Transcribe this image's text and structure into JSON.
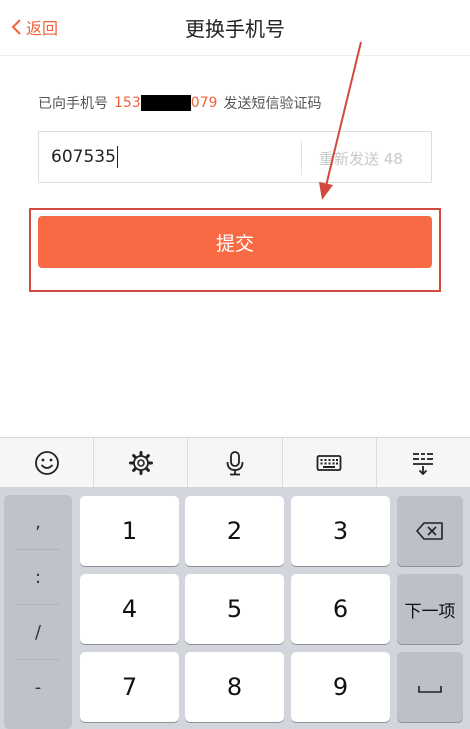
{
  "header": {
    "back_label": "返回",
    "title": "更换手机号"
  },
  "sms_tip": {
    "prefix": "已向手机号",
    "phone_start": "153",
    "phone_end": "079",
    "suffix": "发送短信验证码"
  },
  "code_field": {
    "value": "607535",
    "resend_label": "重新发送",
    "countdown": "48"
  },
  "submit_label": "提交",
  "keyboard": {
    "toolbar": [
      "emoji-icon",
      "gear-icon",
      "microphone-icon",
      "keyboard-icon",
      "collapse-keyboard-icon"
    ],
    "symbols": [
      ",",
      ":",
      "/",
      "-"
    ],
    "keys": [
      "1",
      "2",
      "3",
      "4",
      "5",
      "6",
      "7",
      "8",
      "9"
    ],
    "next_label": "下一项",
    "delete_icon": "backspace-icon",
    "space_icon": "space-icon"
  },
  "colors": {
    "accent": "#f2623a",
    "button": "#f86a44",
    "annotation": "#d24a3e"
  }
}
